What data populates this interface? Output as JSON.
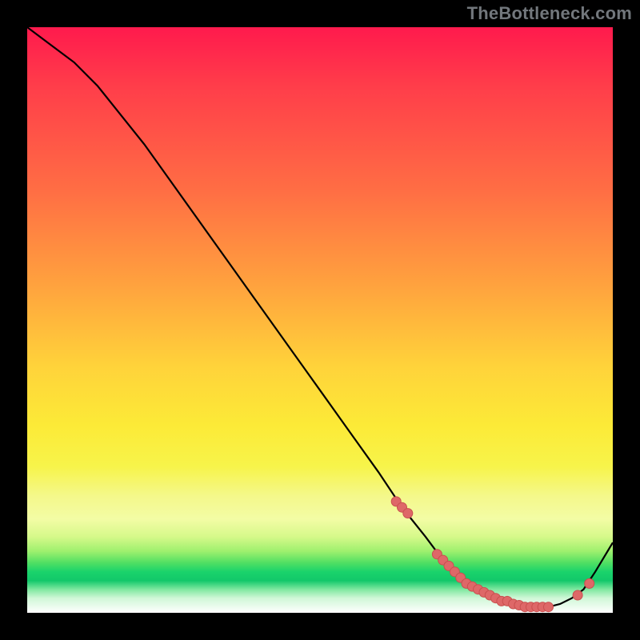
{
  "attribution": "TheBottleneck.com",
  "colors": {
    "frame": "#000000",
    "curve_stroke": "#000000",
    "marker_fill": "#de6868",
    "marker_stroke": "#c94f4f"
  },
  "chart_data": {
    "type": "line",
    "title": "",
    "xlabel": "",
    "ylabel": "",
    "xlim": [
      0,
      100
    ],
    "ylim": [
      0,
      100
    ],
    "series": [
      {
        "name": "bottleneck-curve",
        "x": [
          0,
          4,
          8,
          12,
          16,
          20,
          25,
          30,
          35,
          40,
          45,
          50,
          55,
          60,
          64,
          68,
          71,
          74,
          77,
          79,
          81,
          83,
          85,
          87,
          89,
          91,
          93,
          95,
          97,
          100
        ],
        "y": [
          100,
          97,
          94,
          90,
          85,
          80,
          73,
          66,
          59,
          52,
          45,
          38,
          31,
          24,
          18,
          13,
          9,
          6,
          4,
          3,
          2,
          1.5,
          1,
          1,
          1,
          1.5,
          2.5,
          4,
          7,
          12
        ]
      }
    ],
    "markers": {
      "name": "highlighted-points",
      "x": [
        63,
        64,
        65,
        70,
        71,
        72,
        73,
        74,
        75,
        76,
        77,
        78,
        79,
        80,
        81,
        82,
        83,
        84,
        85,
        86,
        87,
        88,
        89,
        94,
        96
      ],
      "y": [
        19,
        18,
        17,
        10,
        9,
        8,
        7,
        6,
        5,
        4.5,
        4,
        3.5,
        3,
        2.5,
        2,
        2,
        1.5,
        1.3,
        1,
        1,
        1,
        1,
        1,
        3,
        5
      ]
    }
  }
}
